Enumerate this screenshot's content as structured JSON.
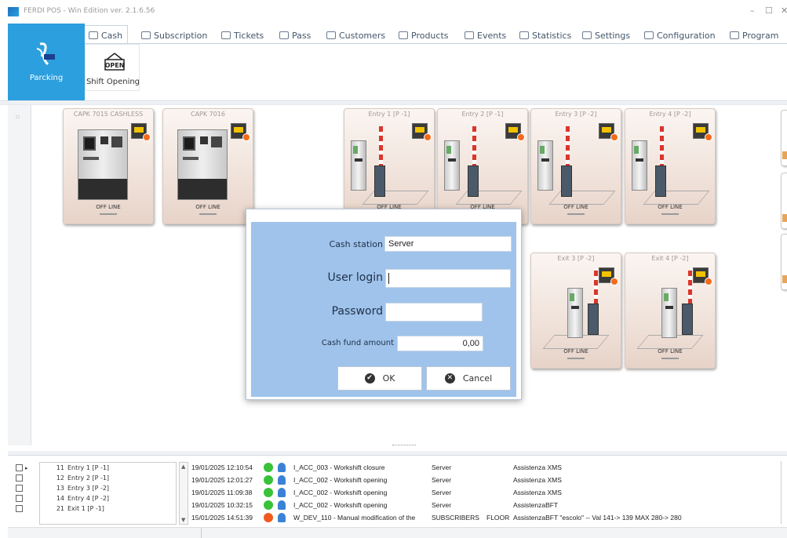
{
  "window": {
    "title": "FERDI POS - Win Edition ver. 2.1.6.56",
    "controls": [
      "–",
      "☐",
      "✕"
    ]
  },
  "ribbon": {
    "home_tile_label": "Parcking",
    "tabs": [
      {
        "label": "Cash",
        "active": true
      },
      {
        "label": "Subscription"
      },
      {
        "label": "Tickets"
      },
      {
        "label": "Pass"
      },
      {
        "label": "Customers"
      },
      {
        "label": "Products"
      },
      {
        "label": "Events"
      },
      {
        "label": "Statistics"
      },
      {
        "label": "Settings"
      },
      {
        "label": "Configuration"
      },
      {
        "label": "Program"
      }
    ],
    "shift_button": {
      "icon_text": "OPEN",
      "label": "Shift Opening"
    }
  },
  "devices": [
    {
      "name": "CAPK 7015 CASHLESS",
      "kind": "cash",
      "status": "OFF LINE"
    },
    {
      "name": "CAPK 7016",
      "kind": "cash",
      "status": "OFF LINE"
    },
    {
      "name": "Entry 1 [P -1]",
      "kind": "entry",
      "status": "OFF LINE"
    },
    {
      "name": "Entry 2 [P -1]",
      "kind": "entry",
      "status": "OFF LINE"
    },
    {
      "name": "Entry 3 [P -2]",
      "kind": "entry",
      "status": "OFF LINE"
    },
    {
      "name": "Entry 4 [P -2]",
      "kind": "entry",
      "status": "OFF LINE"
    },
    {
      "name": "Exit 3 [P -2]",
      "kind": "exit",
      "status": "OFF LINE"
    },
    {
      "name": "Exit 4 [P -2]",
      "kind": "exit",
      "status": "OFF LINE"
    }
  ],
  "dialog": {
    "cash_station_label": "Cash station",
    "cash_station_value": "Server",
    "user_login_label": "User login",
    "user_login_value": "",
    "password_label": "Password",
    "password_value": "",
    "cash_fund_label": "Cash fund amount",
    "cash_fund_value": "0,00",
    "ok_label": "OK",
    "cancel_label": "Cancel"
  },
  "device_list": [
    {
      "num": "11",
      "name": "Entry 1 [P -1]"
    },
    {
      "num": "12",
      "name": "Entry 2 [P -1]"
    },
    {
      "num": "13",
      "name": "Entry 3 [P -2]"
    },
    {
      "num": "14",
      "name": "Entry 4 [P -2]"
    },
    {
      "num": "21",
      "name": "Exit 1 [P -1]"
    }
  ],
  "events": [
    {
      "time": "19/01/2025 12:10:54",
      "status_color": "#39c239",
      "event": "I_ACC_003 - Workshift closure",
      "station": "Server",
      "floor": "",
      "operator": "Assistenza XMS"
    },
    {
      "time": "19/01/2025 12:01:27",
      "status_color": "#39c239",
      "event": "I_ACC_002 - Workshift opening",
      "station": "Server",
      "floor": "",
      "operator": "Assistenza XMS"
    },
    {
      "time": "19/01/2025 11:09:38",
      "status_color": "#39c239",
      "event": "I_ACC_002 - Workshift opening",
      "station": "Server",
      "floor": "",
      "operator": "Assistenza XMS"
    },
    {
      "time": "19/01/2025 10:32:15",
      "status_color": "#39c239",
      "event": "I_ACC_002 - Workshift opening",
      "station": "Server",
      "floor": "",
      "operator": "AssistenzaBFT"
    },
    {
      "time": "15/01/2025 14:51:39",
      "status_color": "#ef5a1f",
      "event": "W_DEV_110 - Manual modification of the",
      "station": "SUBSCRIBERS",
      "floor": "FLOOR",
      "operator": "AssistenzaBFT \"escolo\" -- Val 141-> 139 MAX 280-> 280"
    }
  ]
}
